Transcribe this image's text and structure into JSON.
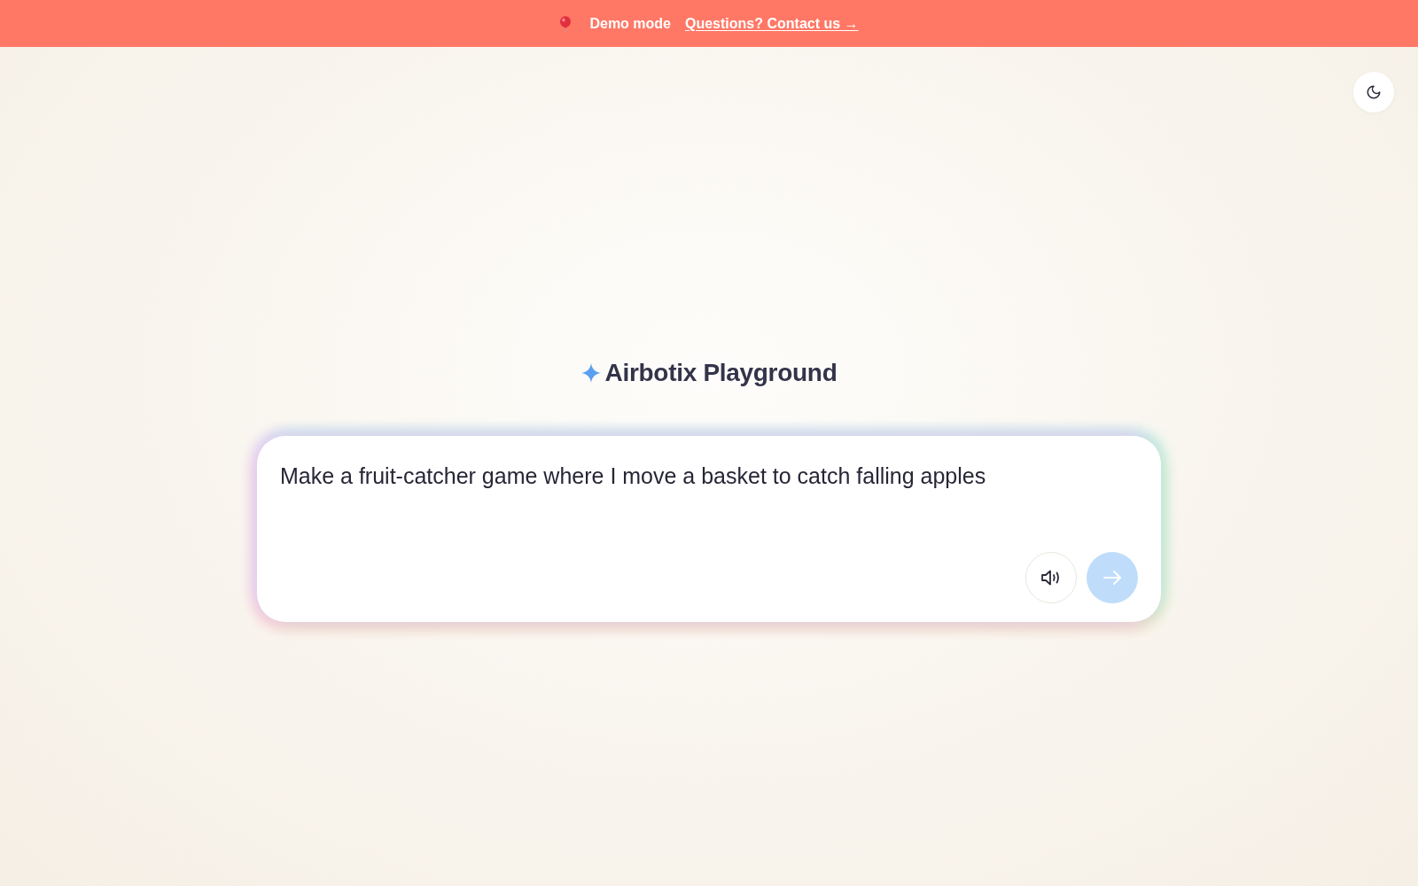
{
  "banner": {
    "label": "Demo mode",
    "link": "Questions? Contact us →"
  },
  "title": "Airbotix Playground",
  "prompt": {
    "value": "Make a fruit-catcher game where I move a basket to catch falling apples"
  }
}
